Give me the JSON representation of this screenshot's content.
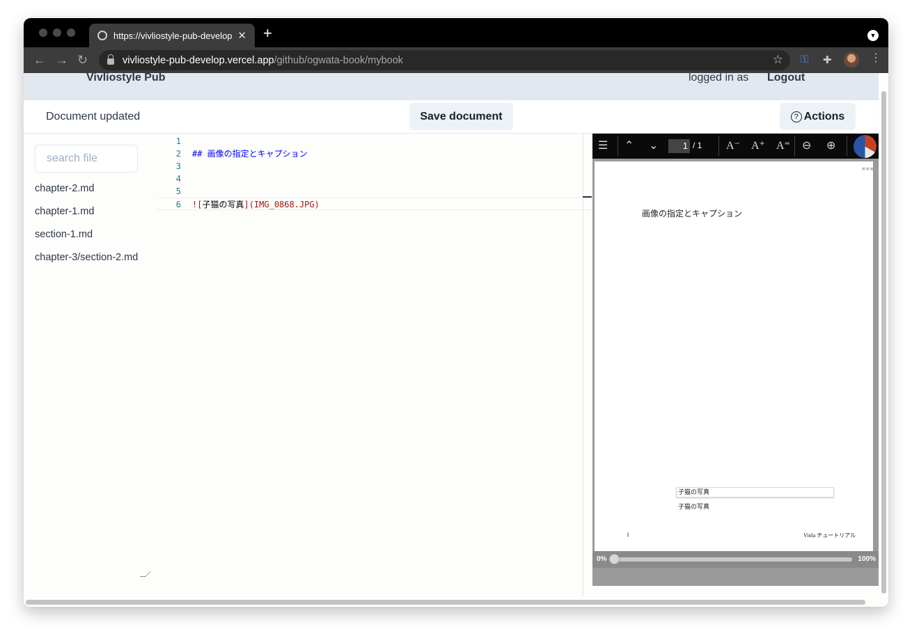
{
  "browser": {
    "tab_title": "https://vivliostyle-pub-develop",
    "url_host": "vivliostyle-pub-develop.vercel.app",
    "url_path": "/github/ogwata-book/mybook"
  },
  "header": {
    "brand": "Vivliostyle Pub",
    "logged_in_label": "logged in as",
    "logout_label": "Logout"
  },
  "actionbar": {
    "status": "Document updated",
    "save_label": "Save document",
    "actions_label": "Actions"
  },
  "sidebar": {
    "search_placeholder": "search file",
    "files": [
      {
        "label": "chapter-2.md"
      },
      {
        "label": "chapter-1.md"
      },
      {
        "label": "section-1.md"
      },
      {
        "label": "chapter-3/section-2.md"
      }
    ]
  },
  "editor": {
    "line_numbers": [
      "1",
      "2",
      "3",
      "4",
      "5",
      "6"
    ],
    "line2": "## 画像の指定とキャプション",
    "line6": {
      "bang_bracket": "![",
      "alt": "子猫の写真",
      "close_url": "](IMG_0868.JPG)"
    }
  },
  "viewer": {
    "current_page": "1",
    "page_total": "/ 1",
    "page_title": "画像の指定とキャプション",
    "image_alt": "子猫の写真",
    "caption": "子猫の写真",
    "folio": "1",
    "running_head": "Viola チュートリアル",
    "progress_start": "0%",
    "progress_end": "100%",
    "progress_value": 0
  }
}
